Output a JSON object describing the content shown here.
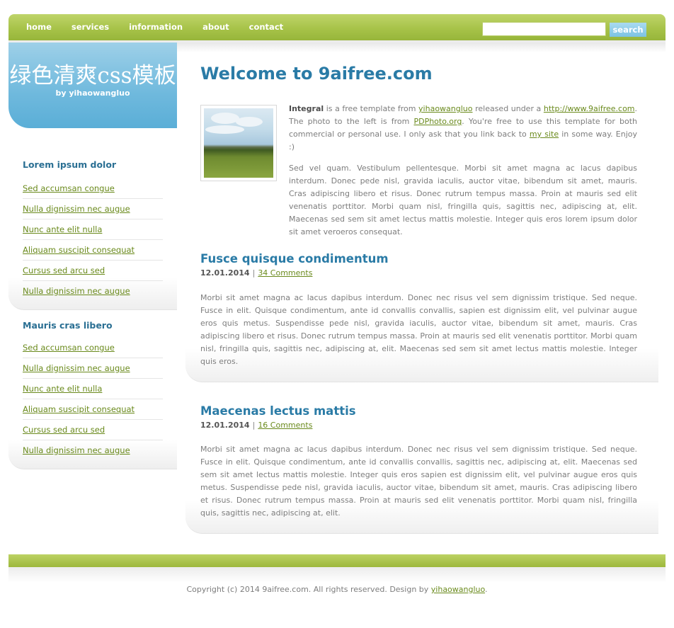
{
  "nav": {
    "items": [
      "home",
      "services",
      "information",
      "about",
      "contact"
    ],
    "search_placeholder": "",
    "search_button": "search"
  },
  "logo": {
    "title": "绿色清爽css模板",
    "byline": "by yihaowangluo"
  },
  "sidebar": {
    "boxes": [
      {
        "title": "Lorem ipsum dolor",
        "links": [
          "Sed accumsan congue",
          "Nulla dignissim nec augue",
          "Nunc ante elit nulla",
          "Aliquam suscipit consequat",
          "Cursus sed arcu sed",
          "Nulla dignissim nec augue"
        ]
      },
      {
        "title": "Mauris cras libero",
        "links": [
          "Sed accumsan congue",
          "Nulla dignissim nec augue",
          "Nunc ante elit nulla",
          "Aliquam suscipit consequat",
          "Cursus sed arcu sed",
          "Nulla dignissim nec augue"
        ]
      }
    ]
  },
  "main": {
    "title": "Welcome to 9aifree.com",
    "intro": {
      "bold": "Integral",
      "t1": " is a free template from ",
      "link1": "yihaowangluo",
      "t2": " released under a ",
      "link2": "http://www.9aifree.com",
      "t3": ". The photo to the left is from ",
      "link3": "PDPhoto.org",
      "t4": ". You're free to use this template for both commercial or personal use. I only ask that you link back to ",
      "link4": "my site",
      "t5": " in some way. Enjoy :)"
    },
    "paragraph2": "Sed vel quam. Vestibulum pellentesque. Morbi sit amet magna ac lacus dapibus interdum. Donec pede nisl, gravida iaculis, auctor vitae, bibendum sit amet, mauris. Cras adipiscing libero et risus. Donec rutrum tempus massa. Proin at mauris sed elit venenatis porttitor. Morbi quam nisl, fringilla quis, sagittis nec, adipiscing at, elit. Maecenas sed sem sit amet lectus mattis molestie. Integer quis eros lorem ipsum dolor sit amet veroeros consequat.",
    "posts": [
      {
        "title": "Fusce quisque condimentum",
        "date": "12.01.2014",
        "separator": "|",
        "comments": "34 Comments",
        "body": "Morbi sit amet magna ac lacus dapibus interdum. Donec nec risus vel sem dignissim tristique. Sed neque. Fusce in elit. Quisque condimentum, ante id convallis convallis, sapien est dignissim elit, vel pulvinar augue eros quis metus. Suspendisse pede nisl, gravida iaculis, auctor vitae, bibendum sit amet, mauris. Cras adipiscing libero et risus. Donec rutrum tempus massa. Proin at mauris sed elit venenatis porttitor. Morbi quam nisl, fringilla quis, sagittis nec, adipiscing at, elit. Maecenas sed sem sit amet lectus mattis molestie. Integer quis eros."
      },
      {
        "title": "Maecenas lectus mattis",
        "date": "12.01.2014",
        "separator": "|",
        "comments": "16 Comments",
        "body": "Morbi sit amet magna ac lacus dapibus interdum. Donec nec risus vel sem dignissim tristique. Sed neque. Fusce in elit. Quisque condimentum, ante id convallis convallis, sagittis nec, adipiscing at, elit. Maecenas sed sem sit amet lectus mattis molestie. Integer quis eros sapien est dignissim elit, vel pulvinar augue eros quis metus. Suspendisse pede nisl, gravida iaculis, auctor vitae, bibendum sit amet, mauris. Cras adipiscing libero et risus. Donec rutrum tempus massa. Proin at mauris sed elit venenatis porttitor. Morbi quam nisl, fringilla quis, sagittis nec, adipiscing at, elit."
      }
    ]
  },
  "footer": {
    "text": "Copyright (c) 2014 9aifree.com. All rights reserved. Design by ",
    "link": "yihaowangluo",
    "end": "."
  },
  "colors": {
    "accent_green": "#a7c349",
    "logo_blue": "#6fb9dd",
    "heading_blue": "#2a7ba6",
    "link_green": "#6a8a1c"
  }
}
